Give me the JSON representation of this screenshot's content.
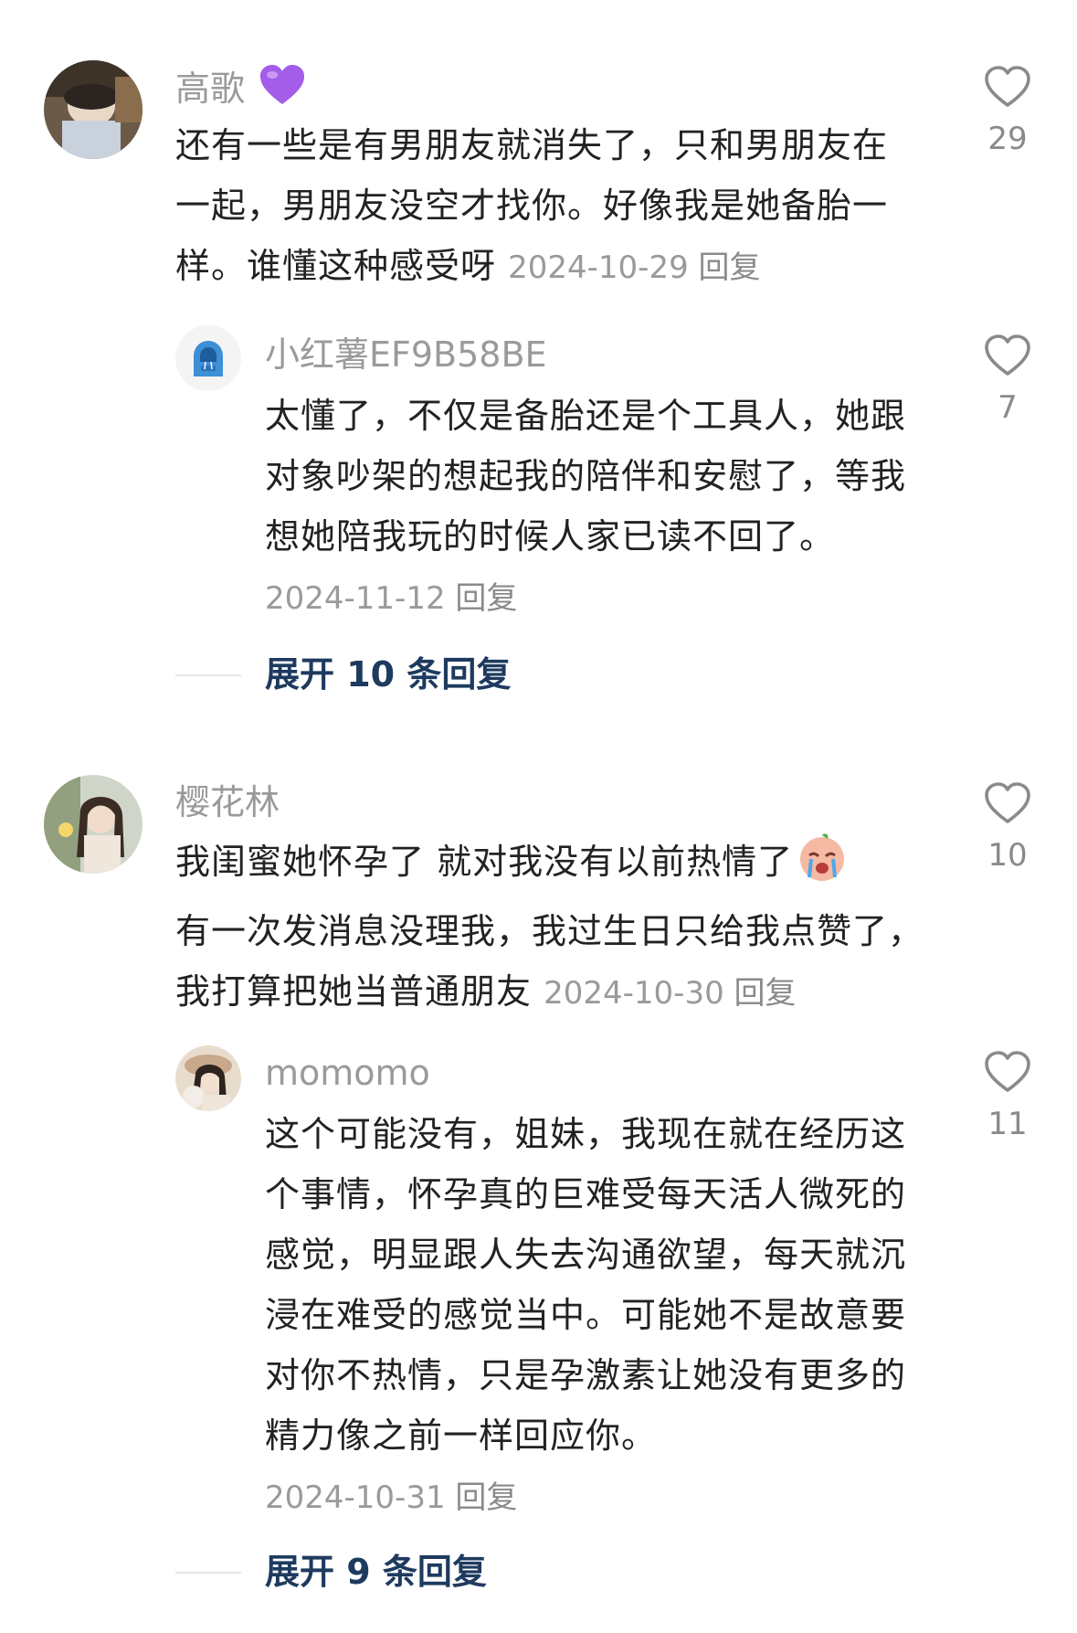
{
  "comments": [
    {
      "username": "高歌",
      "badge_icon": "purple-heart-icon",
      "text": "还有一些是有男朋友就消失了，只和男朋友在一起，男朋友没空才找你。好像我是她备胎一样。谁懂这种感受呀",
      "date": "2024-10-29",
      "reply_label": "回复",
      "likes": "29",
      "replies": [
        {
          "username": "小红薯EF9B58BE",
          "avatar_icon": "blue-hoodie-avatar-icon",
          "text": "太懂了，不仅是备胎还是个工具人，她跟对象吵架的想起我的陪伴和安慰了，等我想她陪我玩的时候人家已读不回了。",
          "date": "2024-11-12",
          "reply_label": "回复",
          "likes": "7"
        }
      ],
      "expand_label": "展开 10 条回复"
    },
    {
      "username": "樱花林",
      "text": "我闺蜜她怀孕了  就对我没有以前热情了",
      "emoji_icon": "crying-face-emoji-icon",
      "text2": "有一次发消息没理我，我过生日只给我点赞了，我打算把她当普通朋友",
      "date": "2024-10-30",
      "reply_label": "回复",
      "likes": "10",
      "replies": [
        {
          "username": "momomo",
          "text": "这个可能没有，姐妹，我现在就在经历这个事情，怀孕真的巨难受每天活人微死的感觉，明显跟人失去沟通欲望，每天就沉浸在难受的感觉当中。可能她不是故意要对你不热情，只是孕激素让她没有更多的精力像之前一样回应你。",
          "date": "2024-10-31",
          "reply_label": "回复",
          "likes": "11"
        }
      ],
      "expand_label": "展开 9 条回复"
    }
  ],
  "colors": {
    "username": "#9a9a9a",
    "text": "#222222",
    "expand": "#1e3a5f",
    "heart_outline": "#8a8a8a"
  }
}
